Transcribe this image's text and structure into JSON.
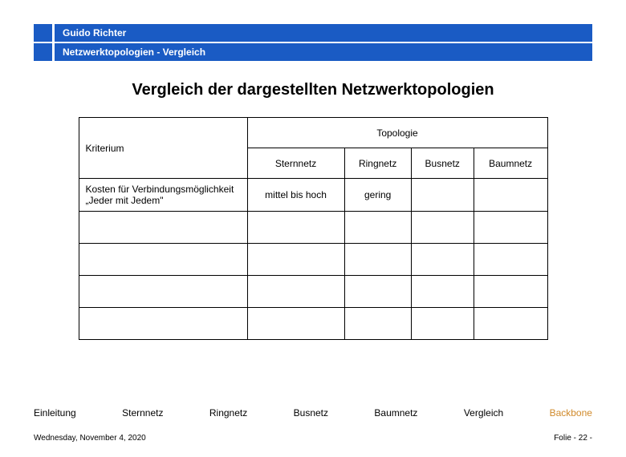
{
  "header": {
    "author": "Guido Richter",
    "topic": "Netzwerktopologien  - Vergleich"
  },
  "title": "Vergleich der dargestellten Netzwerktopologien",
  "table": {
    "kriterium_label": "Kriterium",
    "topologie_label": "Topologie",
    "cols": {
      "stern": "Sternnetz",
      "ring": "Ringnetz",
      "bus": "Busnetz",
      "baum": "Baumnetz"
    },
    "rows": [
      {
        "kriterium": "Kosten für Verbindungsmöglichkeit „Jeder mit Jedem\"",
        "stern": "mittel bis hoch",
        "ring": "gering",
        "bus": "",
        "baum": ""
      }
    ]
  },
  "nav": {
    "items": [
      "Einleitung",
      "Sternnetz",
      "Ringnetz",
      "Busnetz",
      "Baumnetz",
      "Vergleich",
      "Backbone"
    ],
    "active_index": 6
  },
  "footer": {
    "date": "Wednesday, November 4, 2020",
    "page": "Folie - 22 -"
  }
}
